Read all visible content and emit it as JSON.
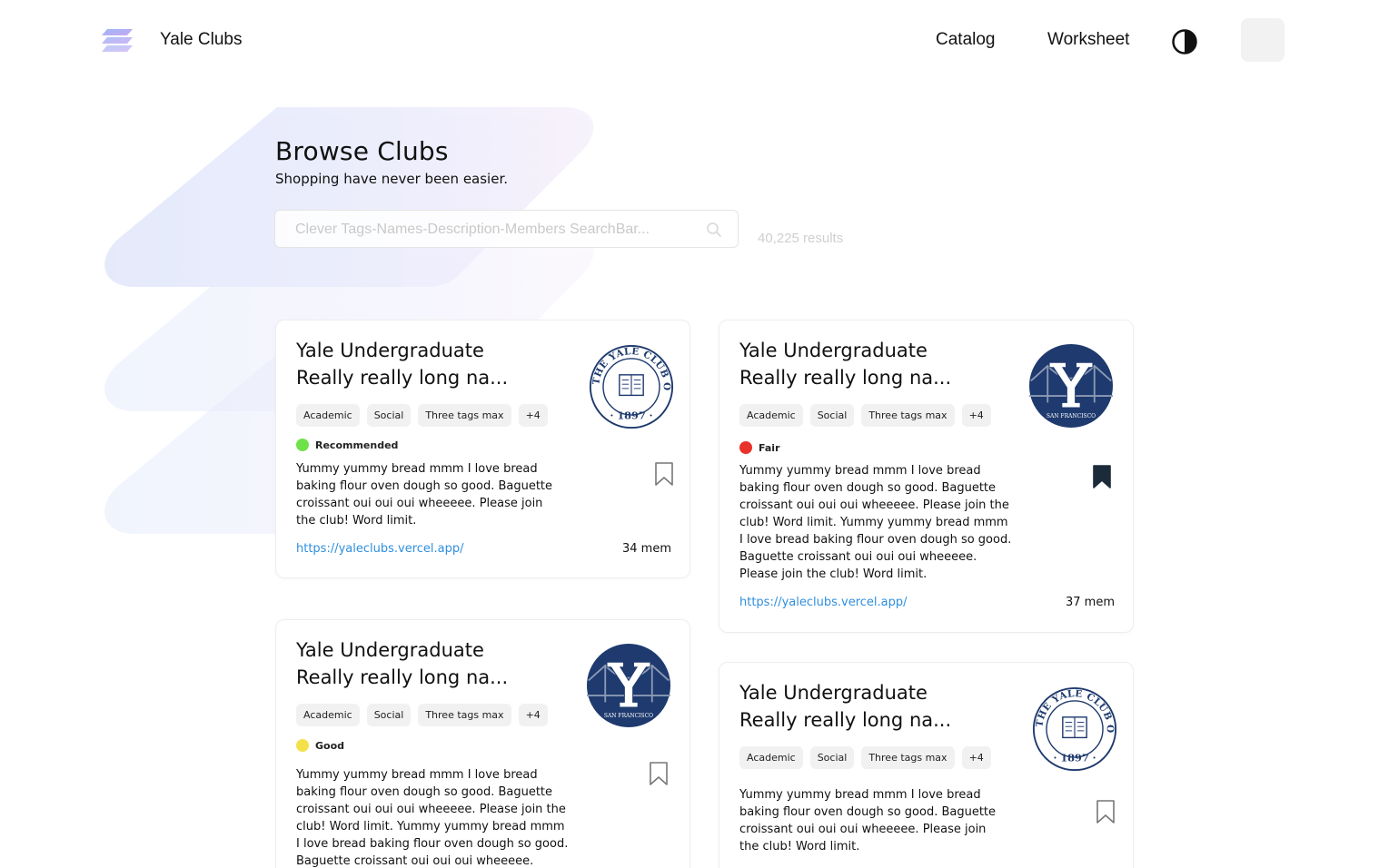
{
  "header": {
    "brand": "Yale Clubs",
    "nav": {
      "catalog": "Catalog",
      "worksheet": "Worksheet"
    }
  },
  "hero": {
    "title": "Browse Clubs",
    "subtitle": "Shopping have never been easier.",
    "search_placeholder": "Clever Tags-Names-Description-Members SearchBar...",
    "results": "40,225 results"
  },
  "colors": {
    "link": "#2f8fde",
    "status_recommended": "#6fe24a",
    "status_fair": "#e8322a",
    "status_good": "#f4e04a",
    "seal_navy": "#1e3a6e"
  },
  "cards": [
    {
      "title_line1": "Yale Undergraduate",
      "title_line2": "Really really long na...",
      "tags": [
        "Academic",
        "Social",
        "Three tags max",
        "+4"
      ],
      "status": "Recommended",
      "desc": [
        "Yummy yummy bread mmm I love bread",
        "baking flour oven dough so good. Baguette",
        "croissant oui oui oui wheeeee. Please join",
        "the club! Word limit."
      ],
      "link": "https://yaleclubs.vercel.app/",
      "members": "34 mem",
      "logo": "nyc-seal-icon",
      "bookmarked": false
    },
    {
      "title_line1": "Yale Undergraduate",
      "title_line2": "Really really long na...",
      "tags": [
        "Academic",
        "Social",
        "Three tags max",
        "+4"
      ],
      "status": "Fair",
      "desc": [
        "Yummy yummy bread mmm I love bread",
        "baking flour oven dough so good. Baguette",
        "croissant oui oui oui wheeeee. Please join the",
        "club! Word limit. Yummy yummy bread mmm",
        "I love bread baking flour oven dough so good.",
        "Baguette croissant oui oui oui wheeeee.",
        "Please join the club! Word limit."
      ],
      "link": "https://yaleclubs.vercel.app/",
      "members": "37 mem",
      "logo": "sf-y-logo-icon",
      "bookmarked": true
    },
    {
      "title_line1": "Yale Undergraduate",
      "title_line2": "Really really long na...",
      "tags": [
        "Academic",
        "Social",
        "Three tags max",
        "+4"
      ],
      "status": "Good",
      "desc": [
        "Yummy yummy bread mmm I love bread",
        "baking flour oven dough so good. Baguette",
        "croissant oui oui oui wheeeee. Please join the",
        "club! Word limit. Yummy yummy bread mmm",
        "I love bread baking flour oven dough so good.",
        "Baguette croissant oui oui oui wheeeee."
      ],
      "logo": "sf-y-logo-icon",
      "bookmarked": false
    },
    {
      "title_line1": "Yale Undergraduate",
      "title_line2": "Really really long na...",
      "tags": [
        "Academic",
        "Social",
        "Three tags max",
        "+4"
      ],
      "desc": [
        "Yummy yummy bread mmm I love bread",
        "baking flour oven dough so good. Baguette",
        "croissant oui oui oui wheeeee. Please join",
        "the club! Word limit."
      ],
      "logo": "nyc-seal-icon",
      "bookmarked": false
    }
  ]
}
